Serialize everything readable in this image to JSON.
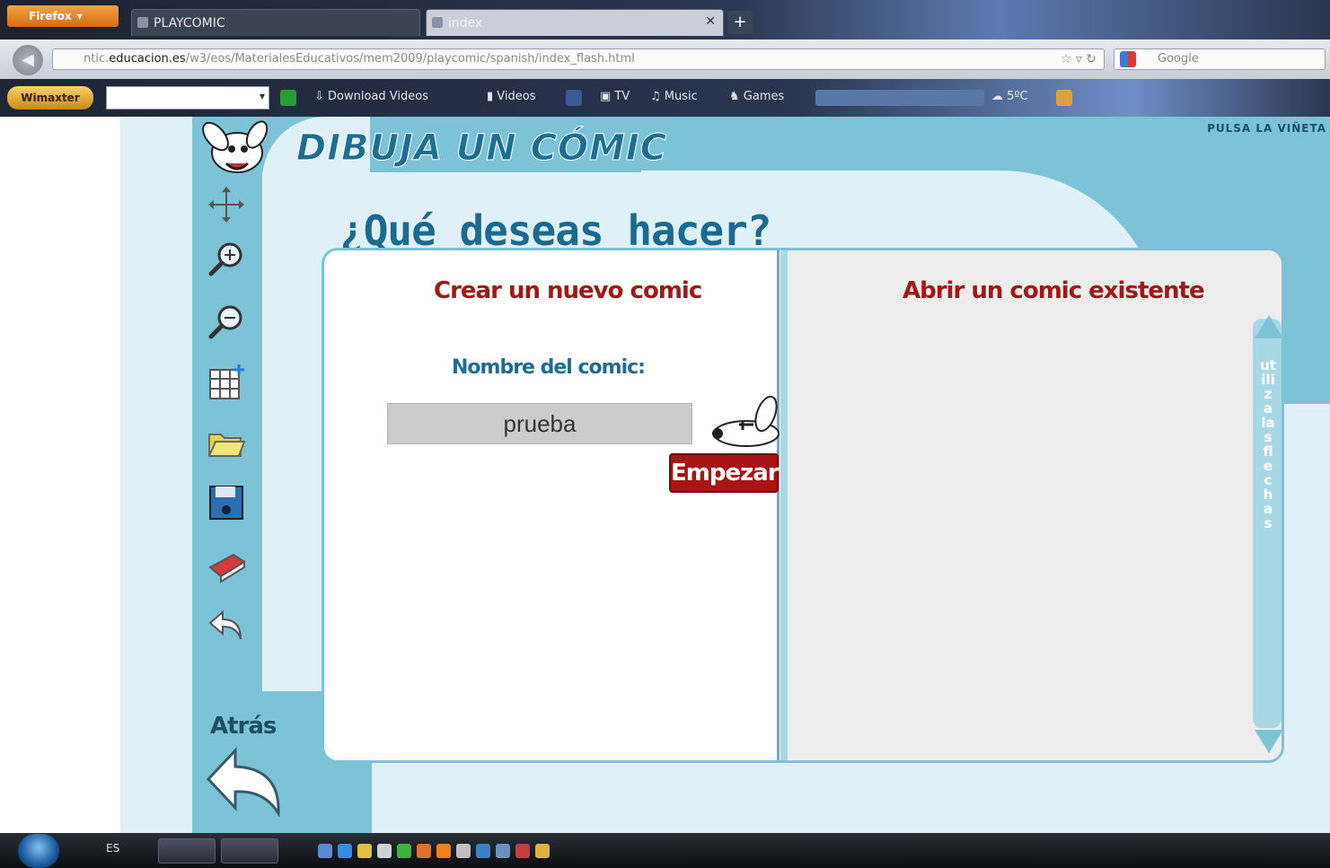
{
  "browser": {
    "menu_button": "Firefox",
    "tabs": [
      {
        "label": "PLAYCOMIC"
      },
      {
        "label": "index"
      }
    ],
    "new_tab": "+",
    "url_prefix": "ntic.",
    "url_host": "educacion.es",
    "url_path": "/w3/eos/MaterialesEducativos/mem2009/playcomic/spanish/index_flash.html",
    "search_placeholder": "Google"
  },
  "toolbar": {
    "logo": "Wimaxter",
    "items": {
      "download_videos": "Download Videos",
      "videos": "Videos",
      "tv": "TV",
      "music": "Music",
      "games": "Games",
      "weather": "5ºC"
    }
  },
  "app": {
    "title": "DIBUJA UN CÓMIC",
    "hint": "PULSA LA VIÑETA",
    "question": "¿Qué deseas hacer?",
    "left_pane": {
      "title": "Crear un nuevo comic",
      "name_label": "Nombre del comic:",
      "name_value": "prueba",
      "start_button": "Empezar"
    },
    "right_pane": {
      "title": "Abrir un comic existente",
      "scroll_hint": "utiliza las flechas"
    },
    "back_label": "Atrás"
  },
  "taskbar": {
    "language": "ES"
  },
  "colors": {
    "accent_blue": "#7cc3d8",
    "title_blue": "#1e6e92",
    "pane_title_red": "#a01818",
    "button_red": "#a81414"
  }
}
